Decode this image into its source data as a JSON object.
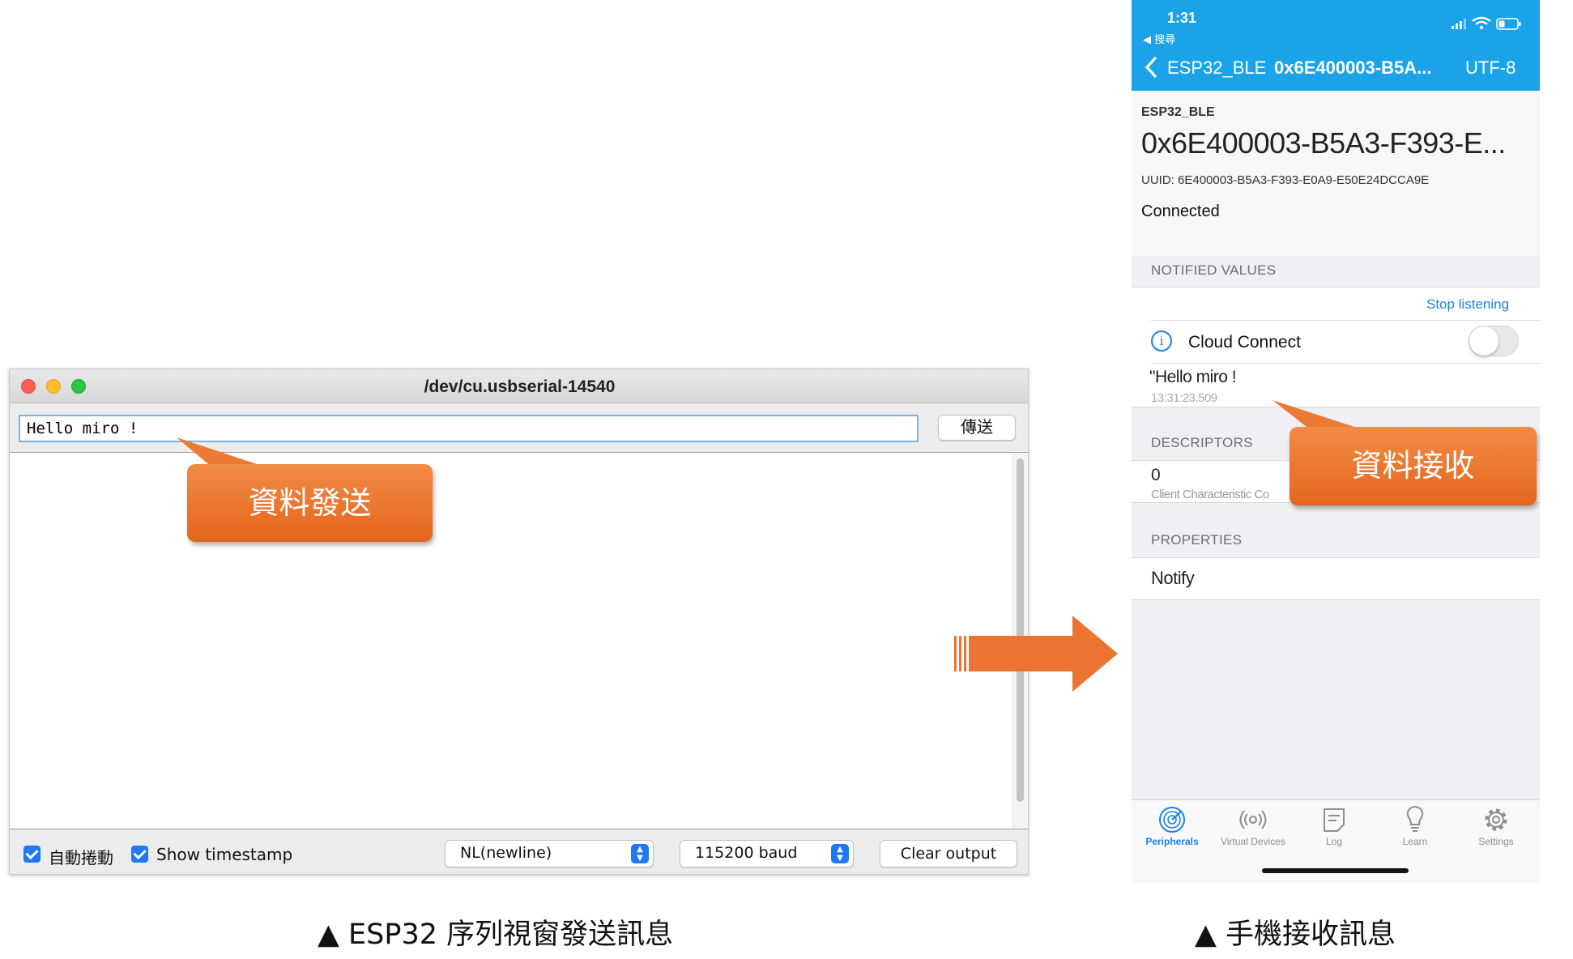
{
  "serial_monitor": {
    "title": "/dev/cu.usbserial-14540",
    "input_value": "Hello miro !",
    "send_label": "傳送",
    "autoscroll_label": "自動捲動",
    "timestamp_label": "Show timestamp",
    "autoscroll_checked": true,
    "timestamp_checked": true,
    "line_ending_selected": "NL(newline)",
    "baud_selected": "115200 baud",
    "clear_label": "Clear output"
  },
  "callouts": {
    "send": "資料發送",
    "receive": "資料接收"
  },
  "phone": {
    "status_time": "1:31",
    "status_back_app": "◀ 搜尋",
    "nav": {
      "device": "ESP32_BLE",
      "uuid": "0x6E400003-B5A...",
      "encoding": "UTF-8"
    },
    "device_name": "ESP32_BLE",
    "characteristic_title": "0x6E400003-B5A3-F393-E...",
    "uuid_line": "UUID: 6E400003-B5A3-F393-E0A9-E50E24DCCA9E",
    "connection_status": "Connected",
    "sections": {
      "notified": "NOTIFIED VALUES",
      "descriptors": "DESCRIPTORS",
      "properties": "PROPERTIES"
    },
    "stop_listening": "Stop listening",
    "cloud_connect": "Cloud Connect",
    "cloud_connect_on": false,
    "notified_value": "\"Hello miro !",
    "notified_time": "13:31:23.509",
    "descriptor_value": "0",
    "descriptor_name": "Client Characteristic Co",
    "property_value": "Notify",
    "tabs": [
      {
        "label": "Peripherals",
        "icon": "peripherals-icon",
        "active": true
      },
      {
        "label": "Virtual Devices",
        "icon": "virtual-devices-icon",
        "active": false
      },
      {
        "label": "Log",
        "icon": "log-icon",
        "active": false
      },
      {
        "label": "Learn",
        "icon": "lightbulb-icon",
        "active": false
      },
      {
        "label": "Settings",
        "icon": "gear-icon",
        "active": false
      }
    ]
  },
  "captions": {
    "left": "▲  ESP32 序列視窗發送訊息",
    "right": "▲  手機接收訊息"
  },
  "colors": {
    "accent_orange": "#e8702a",
    "ios_nav_blue": "#1aa3e8",
    "ios_tint": "#1a84e8",
    "checkbox_blue": "#1e79f3"
  }
}
